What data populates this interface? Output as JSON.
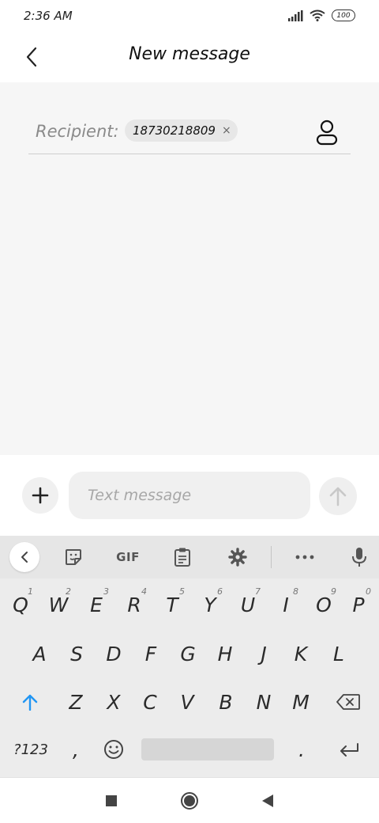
{
  "status_bar": {
    "time": "2:36 AM",
    "battery": "100"
  },
  "header": {
    "title": "New message"
  },
  "recipient": {
    "label": "Recipient:",
    "number": "18730218809",
    "remove_glyph": "×"
  },
  "composer": {
    "placeholder": "Text message"
  },
  "keyboard": {
    "toolbar": {
      "gif_label": "GIF"
    },
    "row1": [
      {
        "key": "Q",
        "hint": "1"
      },
      {
        "key": "W",
        "hint": "2"
      },
      {
        "key": "E",
        "hint": "3"
      },
      {
        "key": "R",
        "hint": "4"
      },
      {
        "key": "T",
        "hint": "5"
      },
      {
        "key": "Y",
        "hint": "6"
      },
      {
        "key": "U",
        "hint": "7"
      },
      {
        "key": "I",
        "hint": "8"
      },
      {
        "key": "O",
        "hint": "9"
      },
      {
        "key": "P",
        "hint": "0"
      }
    ],
    "row2": [
      "A",
      "S",
      "D",
      "F",
      "G",
      "H",
      "J",
      "K",
      "L"
    ],
    "row3": [
      "Z",
      "X",
      "C",
      "V",
      "B",
      "N",
      "M"
    ],
    "row4": {
      "symbols": "?123",
      "comma": ",",
      "period": "."
    }
  },
  "colors": {
    "accent": "#2196f3",
    "background": "#f6f6f6",
    "keyboard": "#ececec"
  },
  "icons": [
    "back-arrow-icon",
    "contact-icon",
    "plus-icon",
    "send-arrow-icon",
    "collapse-icon",
    "sticker-icon",
    "clipboard-icon",
    "gear-icon",
    "more-icon",
    "microphone-icon",
    "shift-icon",
    "emoji-icon",
    "backspace-icon",
    "enter-icon",
    "square-icon",
    "circle-icon",
    "triangle-back-icon",
    "signal-icon",
    "wifi-icon"
  ]
}
